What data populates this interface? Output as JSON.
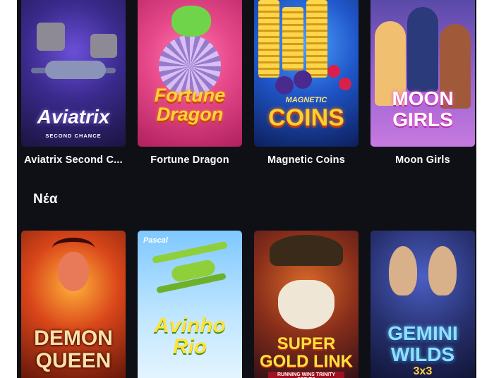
{
  "top_row": [
    {
      "title": "Aviatrix Second C...",
      "logo": "Aviatrix",
      "logo_sub": "SECOND CHANCE",
      "accent": "#6b4fd8"
    },
    {
      "title": "Fortune Dragon",
      "logo": "Fortune Dragon",
      "accent": "#e84a8c"
    },
    {
      "title": "Magnetic Coins",
      "logo": "COINS",
      "logo_sub": "MAGNETIC",
      "accent": "#1f56c9"
    },
    {
      "title": "Moon Girls",
      "logo": "MOON GIRLS",
      "accent": "#8f5fcf"
    }
  ],
  "new_section": {
    "heading": "Νέα",
    "games": [
      {
        "logo": "DEMON QUEEN",
        "accent": "#d9461a"
      },
      {
        "logo": "Avinho Rio",
        "brand": "Pascal",
        "accent": "#7fc8ff"
      },
      {
        "logo": "SUPER GOLD LINK",
        "logo_sub": "RUNNING WINS TRINITY SERIES",
        "accent": "#8a2f1a"
      },
      {
        "logo": "GEMINI WILDS",
        "logo_sub": "3x3",
        "accent": "#27306e"
      }
    ]
  },
  "colors": {
    "panel_bg": "#0e1015",
    "page_bg": "#ffffff",
    "text": "#ffffff"
  }
}
